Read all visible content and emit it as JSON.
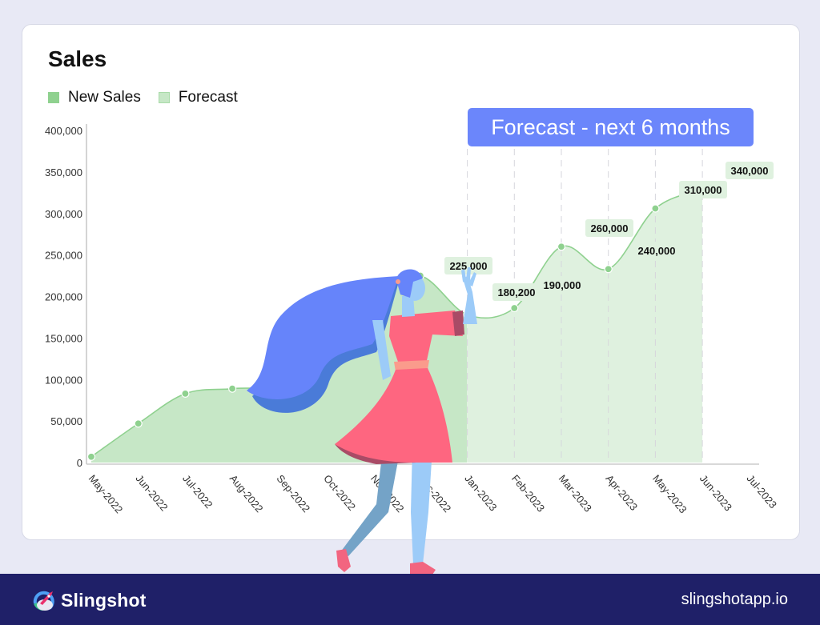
{
  "chart_data": {
    "type": "area",
    "title": "Sales",
    "xlabel": "",
    "ylabel": "",
    "categories": [
      "May-2022",
      "Jun-2022",
      "Jul-2022",
      "Aug-2022",
      "Sep-2022",
      "Oct-2022",
      "Nov-2022",
      "Dec-2022",
      "Jan-2023",
      "Feb-2023",
      "Mar-2023",
      "Apr-2023",
      "May-2023",
      "Jun-2023",
      "Jul-2023"
    ],
    "series": [
      {
        "name": "New Sales",
        "color": "#8fd18f",
        "fill": "#c6e7c6",
        "values": [
          7000,
          47000,
          83000,
          89000,
          95000,
          140000,
          205000,
          225000,
          null,
          null,
          null,
          null,
          null,
          null,
          null
        ]
      },
      {
        "name": "Forecast",
        "color": "#8fd18f",
        "fill": "#dff1df",
        "values": [
          null,
          null,
          null,
          null,
          null,
          null,
          null,
          225000,
          180200,
          190000,
          260000,
          240000,
          310000,
          340000,
          null
        ]
      }
    ],
    "plotted_values": [
      7000,
      47000,
      83000,
      89000,
      95000,
      140000,
      205000,
      225000,
      178000,
      186000,
      260000,
      233000,
      306000,
      329000
    ],
    "data_labels": [
      {
        "category": "Dec-2022",
        "text": "225,000"
      },
      {
        "category": "Jan-2023",
        "text": "180,200"
      },
      {
        "category": "Feb-2023",
        "text": "190,000"
      },
      {
        "category": "Mar-2023",
        "text": "260,000"
      },
      {
        "category": "Apr-2023",
        "text": "240,000"
      },
      {
        "category": "May-2023",
        "text": "310,000"
      },
      {
        "category": "Jun-2023",
        "text": "340,000"
      }
    ],
    "yticks": [
      "0",
      "50,000",
      "100,000",
      "150,000",
      "200,000",
      "250,000",
      "300,000",
      "350,000",
      "400,000"
    ],
    "ylim": [
      0,
      400000
    ],
    "legend": {
      "position": "top-left",
      "entries": [
        "New Sales",
        "Forecast"
      ]
    },
    "annotation": "Forecast - next 6 months",
    "forecast_start_index": 8,
    "grid": false
  },
  "legend": {
    "new_sales": "New Sales",
    "forecast": "Forecast",
    "new_sales_color": "#8fd18f",
    "forecast_color": "#c6e7c6"
  },
  "banner": {
    "text": "Forecast - next 6 months",
    "color": "#6b86fb"
  },
  "footer": {
    "brand": "Slingshot",
    "site": "slingshotapp.io",
    "background": "#1f2068"
  }
}
